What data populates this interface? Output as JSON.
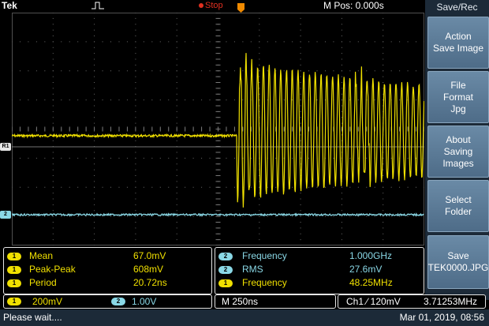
{
  "header": {
    "brand": "Tek",
    "run_state": "Stop",
    "position_readout": "M Pos: 0.000s"
  },
  "graticule": {
    "ref_marker_label": "R1",
    "ch2_marker_label": "2",
    "trigger_marker_label": "T"
  },
  "menu": {
    "title": "Save/Rec",
    "buttons": [
      {
        "label": "Action\nSave Image"
      },
      {
        "label": "File\nFormat\nJpg"
      },
      {
        "label": "About\nSaving\nImages"
      },
      {
        "label": "Select\nFolder"
      },
      {
        "label": "Save\nTEK0000.JPG"
      }
    ]
  },
  "measurements_left": [
    {
      "channel": "1",
      "name": "Mean",
      "value": "67.0mV"
    },
    {
      "channel": "1",
      "name": "Peak-Peak",
      "value": "608mV"
    },
    {
      "channel": "1",
      "name": "Period",
      "value": "20.72ns"
    }
  ],
  "measurements_right": [
    {
      "channel": "2",
      "name": "Frequency",
      "value": "1.000GHz"
    },
    {
      "channel": "2",
      "name": "RMS",
      "value": "27.6mV"
    },
    {
      "channel": "1",
      "name": "Frequency",
      "value": "48.25MHz"
    }
  ],
  "settings": {
    "ch1_channel": "1",
    "ch1_scale": "200mV",
    "ch2_channel": "2",
    "ch2_scale": "1.00V",
    "timebase": "M 250ns",
    "trigger": "Ch1 ∕ 120mV",
    "trigger_freq": "3.71253MHz"
  },
  "status": {
    "message": "Please wait....",
    "datetime": "Mar 01, 2019, 08:56"
  },
  "colors": {
    "ch1": "#f0e000",
    "ch2": "#8ad8e6",
    "menu_bg": "#1c2a38",
    "trigger_marker": "#f08a00"
  }
}
